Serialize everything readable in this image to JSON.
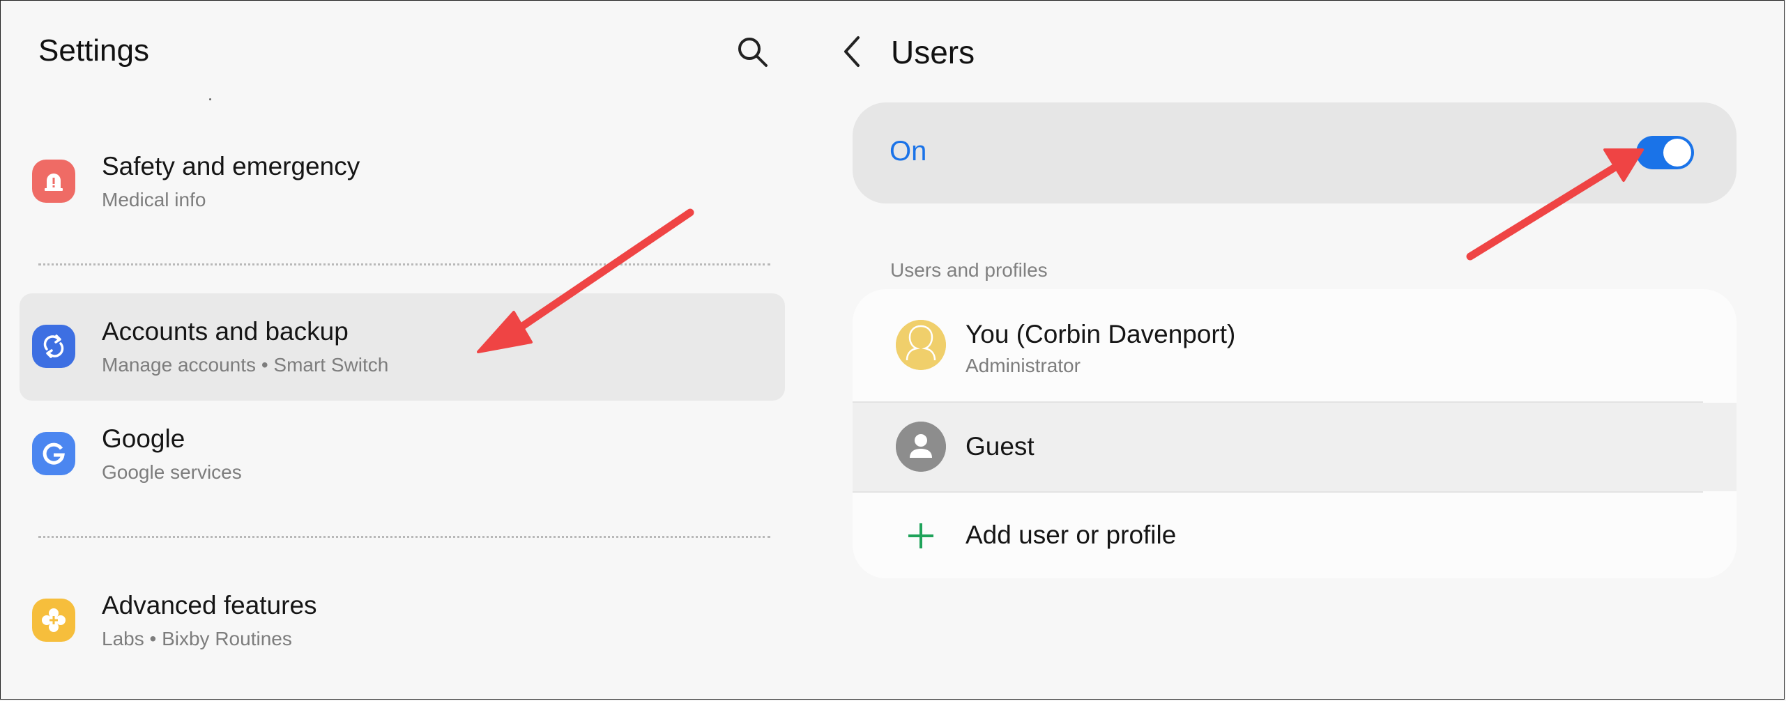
{
  "settings": {
    "title": "Settings",
    "items": [
      {
        "title": "Safety and emergency",
        "subtitle": "Medical info",
        "icon": "alert-icon",
        "color": "#ef6b65"
      },
      {
        "title": "Accounts and backup",
        "subtitle": "Manage accounts  •  Smart Switch",
        "icon": "sync-icon",
        "color": "#3d6fe2",
        "selected": true
      },
      {
        "title": "Google",
        "subtitle": "Google services",
        "icon": "google-icon",
        "color": "#4b86f0"
      },
      {
        "title": "Advanced features",
        "subtitle": "Labs  •  Bixby Routines",
        "icon": "plus-gear-icon",
        "color": "#f6be3c"
      }
    ]
  },
  "users": {
    "title": "Users",
    "master_switch": {
      "label": "On",
      "enabled": true
    },
    "section_label": "Users and profiles",
    "profiles": [
      {
        "name": "You (Corbin Davenport)",
        "role": "Administrator",
        "avatar_color": "#f0cf6b"
      },
      {
        "name": "Guest",
        "avatar_color": "#8d8d8d"
      }
    ],
    "add_label": "Add user or profile"
  },
  "colors": {
    "accent": "#1a73e8",
    "annotation_arrow": "#ef4444",
    "add_icon": "#1fa35a"
  }
}
